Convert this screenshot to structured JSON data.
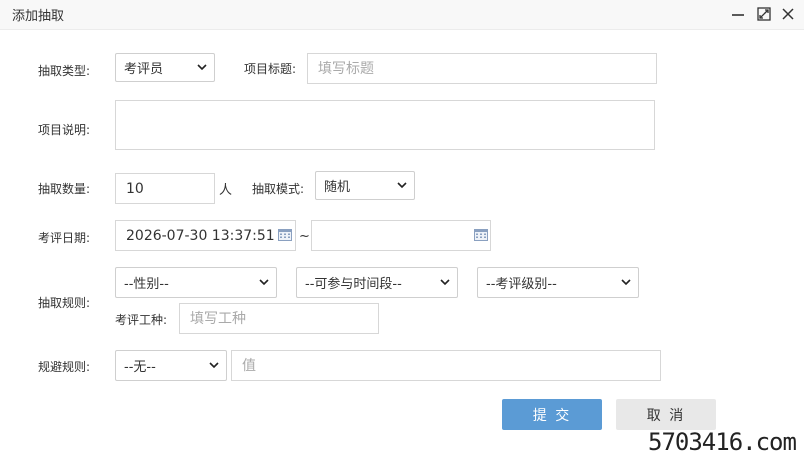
{
  "dialog": {
    "title": "添加抽取"
  },
  "form": {
    "type_label": "抽取类型:",
    "type_value": "考评员",
    "title_label": "项目标题:",
    "title_placeholder": "填写标题",
    "desc_label": "项目说明:",
    "count_label": "抽取数量:",
    "count_value": "10",
    "count_unit": "人",
    "mode_label": "抽取模式:",
    "mode_value": "随机",
    "date_label": "考评日期:",
    "date_start": "2026-07-30 13:37:51",
    "date_sep": "~",
    "rule_label": "抽取规则:",
    "gender_value": "--性别--",
    "period_value": "--可参与时间段--",
    "level_value": "--考评级别--",
    "worktype_label": "考评工种:",
    "worktype_placeholder": "填写工种",
    "avoid_label": "规避规则:",
    "avoid_value": "--无--",
    "avoid_placeholder": "值"
  },
  "buttons": {
    "submit": "提 交",
    "cancel": "取 消"
  },
  "watermark": "5703416.com"
}
